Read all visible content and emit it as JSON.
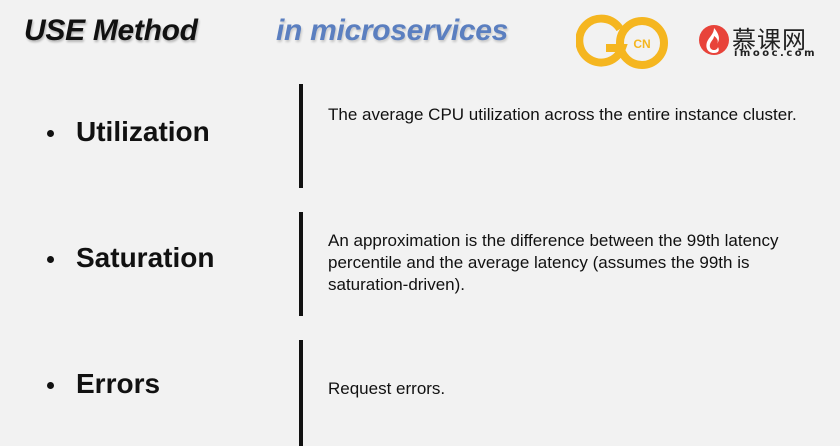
{
  "header": {
    "title": "USE Method",
    "subtitle": "in microservices"
  },
  "logos": {
    "gocn": {
      "text": "CN",
      "color": "#f5b620"
    },
    "imooc": {
      "name": "慕课网",
      "domain": "imooc.com",
      "color": "#e8433a"
    }
  },
  "items": [
    {
      "term": "Utilization",
      "description": "The average CPU utilization across the entire instance cluster."
    },
    {
      "term": "Saturation",
      "description": "An approximation is the difference between the 99th latency percentile and the average latency (assumes the 99th is saturation-driven)."
    },
    {
      "term": "Errors",
      "description": "Request errors."
    }
  ]
}
